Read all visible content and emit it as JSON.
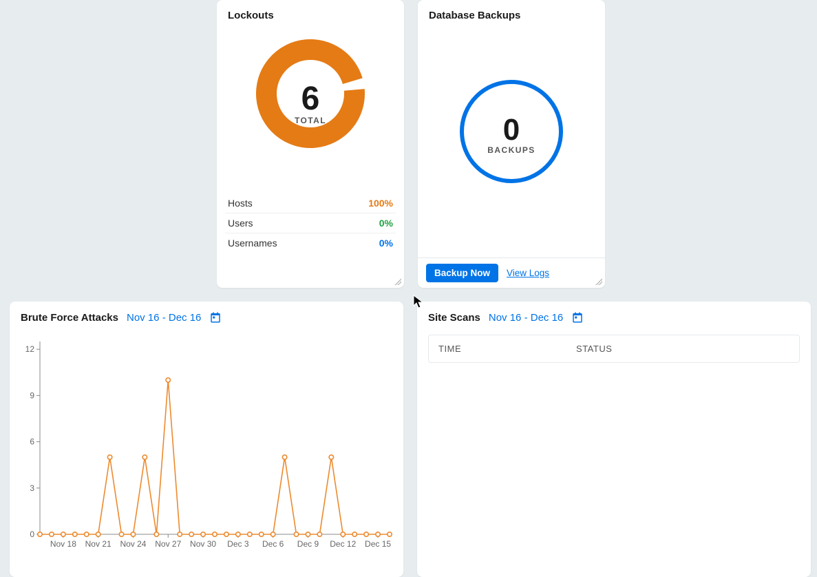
{
  "lockouts": {
    "title": "Lockouts",
    "total_value": "6",
    "total_label": "TOTAL",
    "rows": [
      {
        "label": "Hosts",
        "value": "100%",
        "color": "c-orange"
      },
      {
        "label": "Users",
        "value": "0%",
        "color": "c-green"
      },
      {
        "label": "Usernames",
        "value": "0%",
        "color": "c-blue"
      }
    ]
  },
  "backups": {
    "title": "Database Backups",
    "count": "0",
    "count_label": "BACKUPS",
    "backup_now": "Backup Now",
    "view_logs": "View Logs"
  },
  "bruteforce": {
    "title": "Brute Force Attacks",
    "range": "Nov 16 - Dec 16"
  },
  "scans": {
    "title": "Site Scans",
    "range": "Nov 16 - Dec 16",
    "columns": {
      "time": "TIME",
      "status": "STATUS"
    }
  },
  "chart_data": {
    "type": "line",
    "title": "Brute Force Attacks",
    "xlabel": "",
    "ylabel": "",
    "ylim": [
      0,
      12.5
    ],
    "y_ticks": [
      0,
      3,
      6,
      9,
      12
    ],
    "x_tick_labels": [
      "Nov 18",
      "Nov 21",
      "Nov 24",
      "Nov 27",
      "Nov 30",
      "Dec 3",
      "Dec 6",
      "Dec 9",
      "Dec 12",
      "Dec 15"
    ],
    "categories": [
      "Nov 16",
      "Nov 17",
      "Nov 18",
      "Nov 19",
      "Nov 20",
      "Nov 21",
      "Nov 22",
      "Nov 23",
      "Nov 24",
      "Nov 25",
      "Nov 26",
      "Nov 27",
      "Nov 28",
      "Nov 29",
      "Nov 30",
      "Dec 1",
      "Dec 2",
      "Dec 3",
      "Dec 4",
      "Dec 5",
      "Dec 6",
      "Dec 7",
      "Dec 8",
      "Dec 9",
      "Dec 10",
      "Dec 11",
      "Dec 12",
      "Dec 13",
      "Dec 14",
      "Dec 15",
      "Dec 16"
    ],
    "values": [
      0,
      0,
      0,
      0,
      0,
      0,
      5,
      0,
      0,
      5,
      0,
      10,
      0,
      0,
      0,
      0,
      0,
      0,
      0,
      0,
      0,
      5,
      0,
      0,
      0,
      5,
      0,
      0,
      0,
      0,
      0
    ],
    "accent": "#ec8a2e"
  }
}
